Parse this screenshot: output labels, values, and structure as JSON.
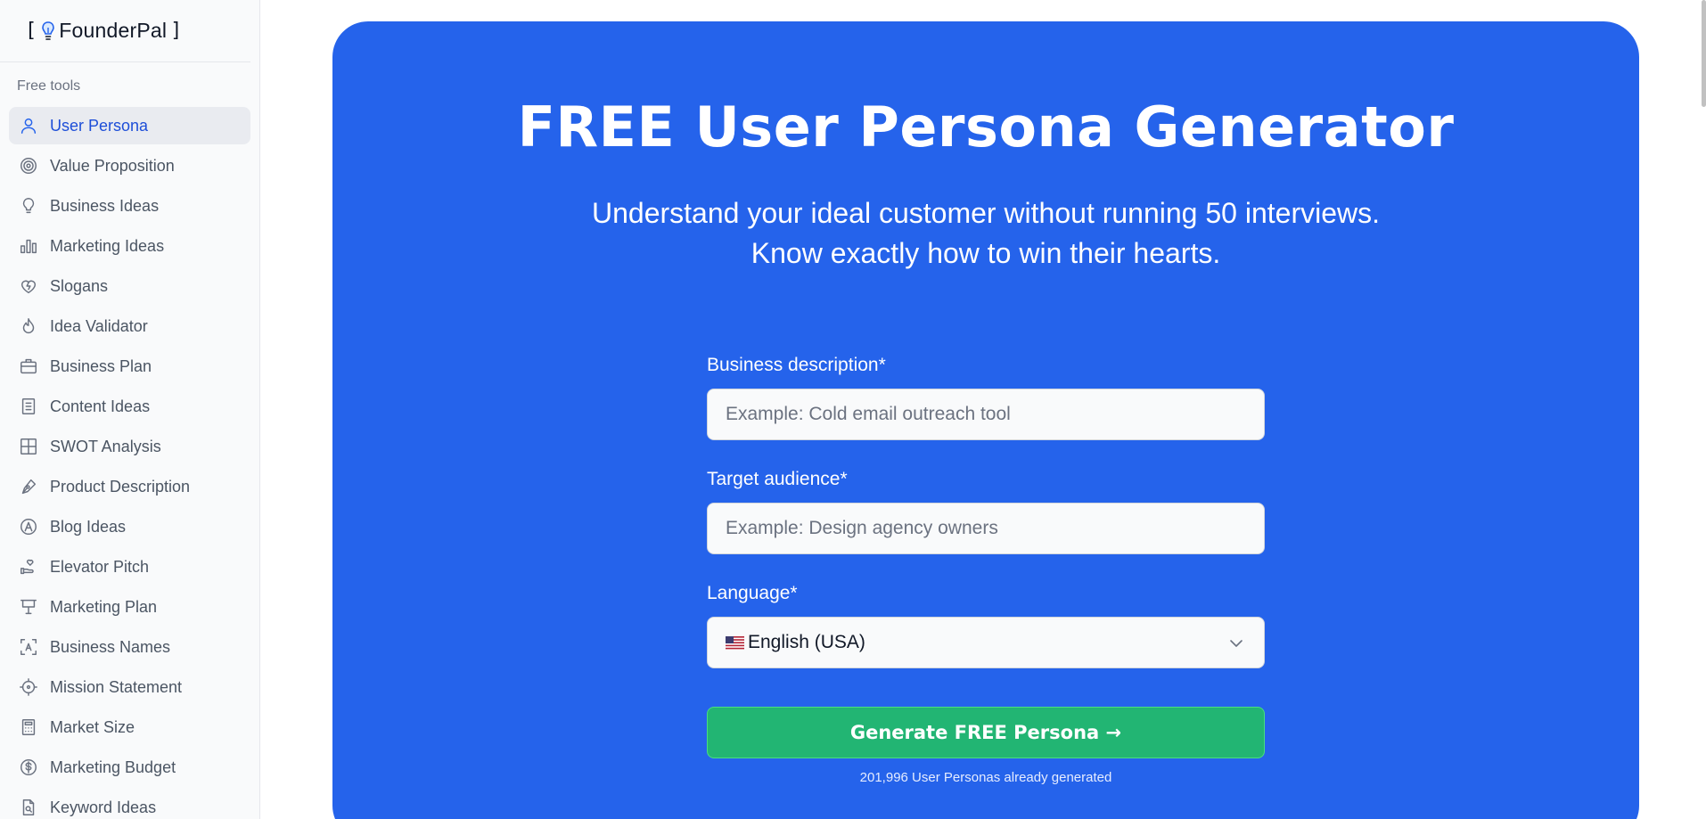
{
  "brand": {
    "open_bracket": "[",
    "name": "FounderPal",
    "close_bracket": "]"
  },
  "sidebar": {
    "section_label": "Free tools",
    "items": [
      {
        "label": "User Persona",
        "icon": "user-icon",
        "active": true
      },
      {
        "label": "Value Proposition",
        "icon": "target-icon"
      },
      {
        "label": "Business Ideas",
        "icon": "lightbulb-icon"
      },
      {
        "label": "Marketing Ideas",
        "icon": "bar-chart-icon"
      },
      {
        "label": "Slogans",
        "icon": "hearts-icon"
      },
      {
        "label": "Idea Validator",
        "icon": "flame-icon"
      },
      {
        "label": "Business Plan",
        "icon": "briefcase-icon"
      },
      {
        "label": "Content Ideas",
        "icon": "document-icon"
      },
      {
        "label": "SWOT Analysis",
        "icon": "grid-icon"
      },
      {
        "label": "Product Description",
        "icon": "pen-icon"
      },
      {
        "label": "Blog Ideas",
        "icon": "compass-icon"
      },
      {
        "label": "Elevator Pitch",
        "icon": "hand-heart-icon"
      },
      {
        "label": "Marketing Plan",
        "icon": "presentation-icon"
      },
      {
        "label": "Business Names",
        "icon": "text-frame-icon"
      },
      {
        "label": "Mission Statement",
        "icon": "crosshair-icon"
      },
      {
        "label": "Market Size",
        "icon": "calculator-icon"
      },
      {
        "label": "Marketing Budget",
        "icon": "dollar-circle-icon"
      },
      {
        "label": "Keyword Ideas",
        "icon": "file-search-icon"
      }
    ]
  },
  "hero": {
    "title": "FREE User Persona Generator",
    "subtitle_line1": "Understand your ideal customer without running 50 interviews.",
    "subtitle_line2": "Know exactly how to win their hearts."
  },
  "form": {
    "business_label": "Business description*",
    "business_placeholder": "Example: Cold email outreach tool",
    "audience_label": "Target audience*",
    "audience_placeholder": "Example: Design agency owners",
    "language_label": "Language*",
    "language_value": "English (USA)",
    "language_flag": "us-flag-icon",
    "submit_label": "Generate FREE Persona →",
    "generated_count": "201,996 User Personas already generated"
  },
  "colors": {
    "hero_bg": "#2563eb",
    "cta_bg": "#22b573",
    "active_nav_text": "#1d4ed8"
  }
}
